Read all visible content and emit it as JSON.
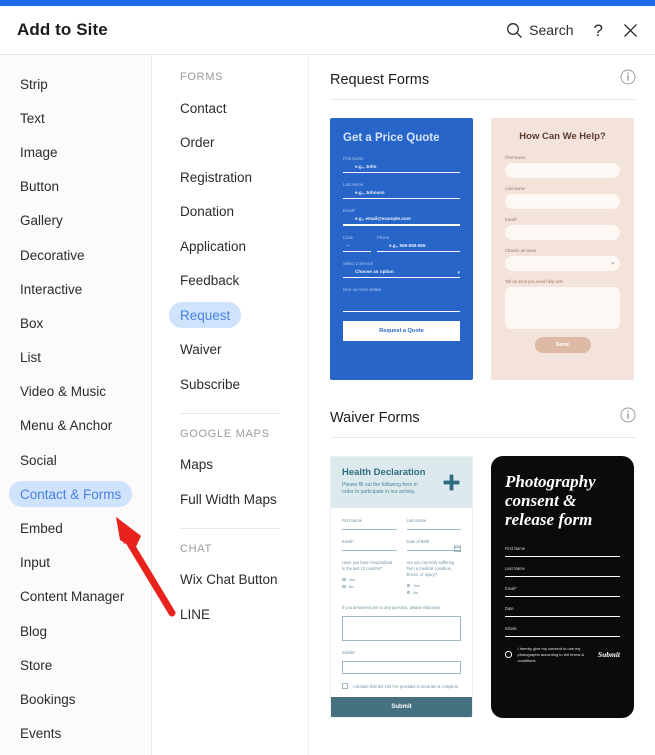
{
  "header": {
    "title": "Add to Site",
    "search_label": "Search",
    "help_label": "?",
    "close_label": "✕"
  },
  "categories": {
    "items": [
      {
        "label": "Strip",
        "selected": false
      },
      {
        "label": "Text",
        "selected": false
      },
      {
        "label": "Image",
        "selected": false
      },
      {
        "label": "Button",
        "selected": false
      },
      {
        "label": "Gallery",
        "selected": false
      },
      {
        "label": "Decorative",
        "selected": false
      },
      {
        "label": "Interactive",
        "selected": false
      },
      {
        "label": "Box",
        "selected": false
      },
      {
        "label": "List",
        "selected": false
      },
      {
        "label": "Video & Music",
        "selected": false
      },
      {
        "label": "Menu & Anchor",
        "selected": false
      },
      {
        "label": "Social",
        "selected": false
      },
      {
        "label": "Contact & Forms",
        "selected": true
      },
      {
        "label": "Embed",
        "selected": false
      },
      {
        "label": "Input",
        "selected": false
      },
      {
        "label": "Content Manager",
        "selected": false
      },
      {
        "label": "Blog",
        "selected": false
      },
      {
        "label": "Store",
        "selected": false
      },
      {
        "label": "Bookings",
        "selected": false
      },
      {
        "label": "Events",
        "selected": false
      }
    ]
  },
  "subnav": {
    "groups": [
      {
        "heading": "FORMS",
        "items": [
          {
            "label": "Contact",
            "selected": false
          },
          {
            "label": "Order",
            "selected": false
          },
          {
            "label": "Registration",
            "selected": false
          },
          {
            "label": "Donation",
            "selected": false
          },
          {
            "label": "Application",
            "selected": false
          },
          {
            "label": "Feedback",
            "selected": false
          },
          {
            "label": "Request",
            "selected": true
          },
          {
            "label": "Waiver",
            "selected": false
          },
          {
            "label": "Subscribe",
            "selected": false
          }
        ]
      },
      {
        "heading": "GOOGLE MAPS",
        "items": [
          {
            "label": "Maps",
            "selected": false
          },
          {
            "label": "Full Width Maps",
            "selected": false
          }
        ]
      },
      {
        "heading": "CHAT",
        "items": [
          {
            "label": "Wix Chat Button",
            "selected": false
          },
          {
            "label": "LINE",
            "selected": false
          }
        ]
      }
    ]
  },
  "main": {
    "sections": [
      {
        "title": "Request Forms",
        "info_icon": "info-icon"
      },
      {
        "title": "Waiver Forms",
        "info_icon": "info-icon"
      }
    ]
  },
  "cards": {
    "price_quote": {
      "title": "Get a Price Quote",
      "fields": [
        {
          "label": "First Name",
          "value": "e.g., John"
        },
        {
          "label": "Last Name",
          "value": "e.g., Johnson"
        },
        {
          "label": "Email*",
          "value": "e.g., email@example.com"
        }
      ],
      "code_label": "Code",
      "code_value": "–",
      "phone_label": "Phone",
      "phone_value": "e.g., 555-555-555",
      "service_label": "Select a Service",
      "service_value": "Choose an option",
      "details_label": "Give us more details",
      "button": "Request a Quote"
    },
    "how_can_we_help": {
      "title": "How Can We Help?",
      "fields": [
        {
          "label": "First Name"
        },
        {
          "label": "Last Name"
        },
        {
          "label": "Email*"
        }
      ],
      "issue_label": "Choose an issue",
      "message_label": "Tell us what you need help with",
      "button": "Send"
    },
    "health_declaration": {
      "title": "Health Declaration",
      "subtitle": "Please fill out the following form in order to participate in our activity.",
      "first_name": "First Name",
      "last_name": "Last Name",
      "email": "Email*",
      "dob": "Date of Birth",
      "q1": "Have you been hospitalized in the last 12 months?",
      "q2": "Are you currently suffering from a medical condition, illness, or injury?",
      "radio_yes": "Yes",
      "radio_no": "No",
      "elaborate_label": "If you answered yes to any question, please elaborate",
      "initials_label": "Initials*",
      "declaration": "I declare that the info I've provided is accurate & complete.",
      "button": "Submit"
    },
    "photography_consent": {
      "title": "Photography consent & release form",
      "fields": [
        {
          "label": "First Name"
        },
        {
          "label": "Last Name"
        },
        {
          "label": "Email*"
        },
        {
          "label": "Date"
        },
        {
          "label": "Initials"
        }
      ],
      "consent": "I hereby give my consent to use my photographs according to the terms & conditions",
      "button": "Submit"
    }
  },
  "annotation": {
    "arrow_color": "#e8221c"
  },
  "colors": {
    "topbar": "#1f6bf0",
    "selected_pill_bg": "#cfe3fd",
    "selected_pill_text": "#4a82e0",
    "price_card": "#2765c8",
    "help_card": "#f3e3da",
    "health_header": "#dceaee",
    "health_button": "#44707f",
    "photo_card": "#0b0b0b"
  }
}
